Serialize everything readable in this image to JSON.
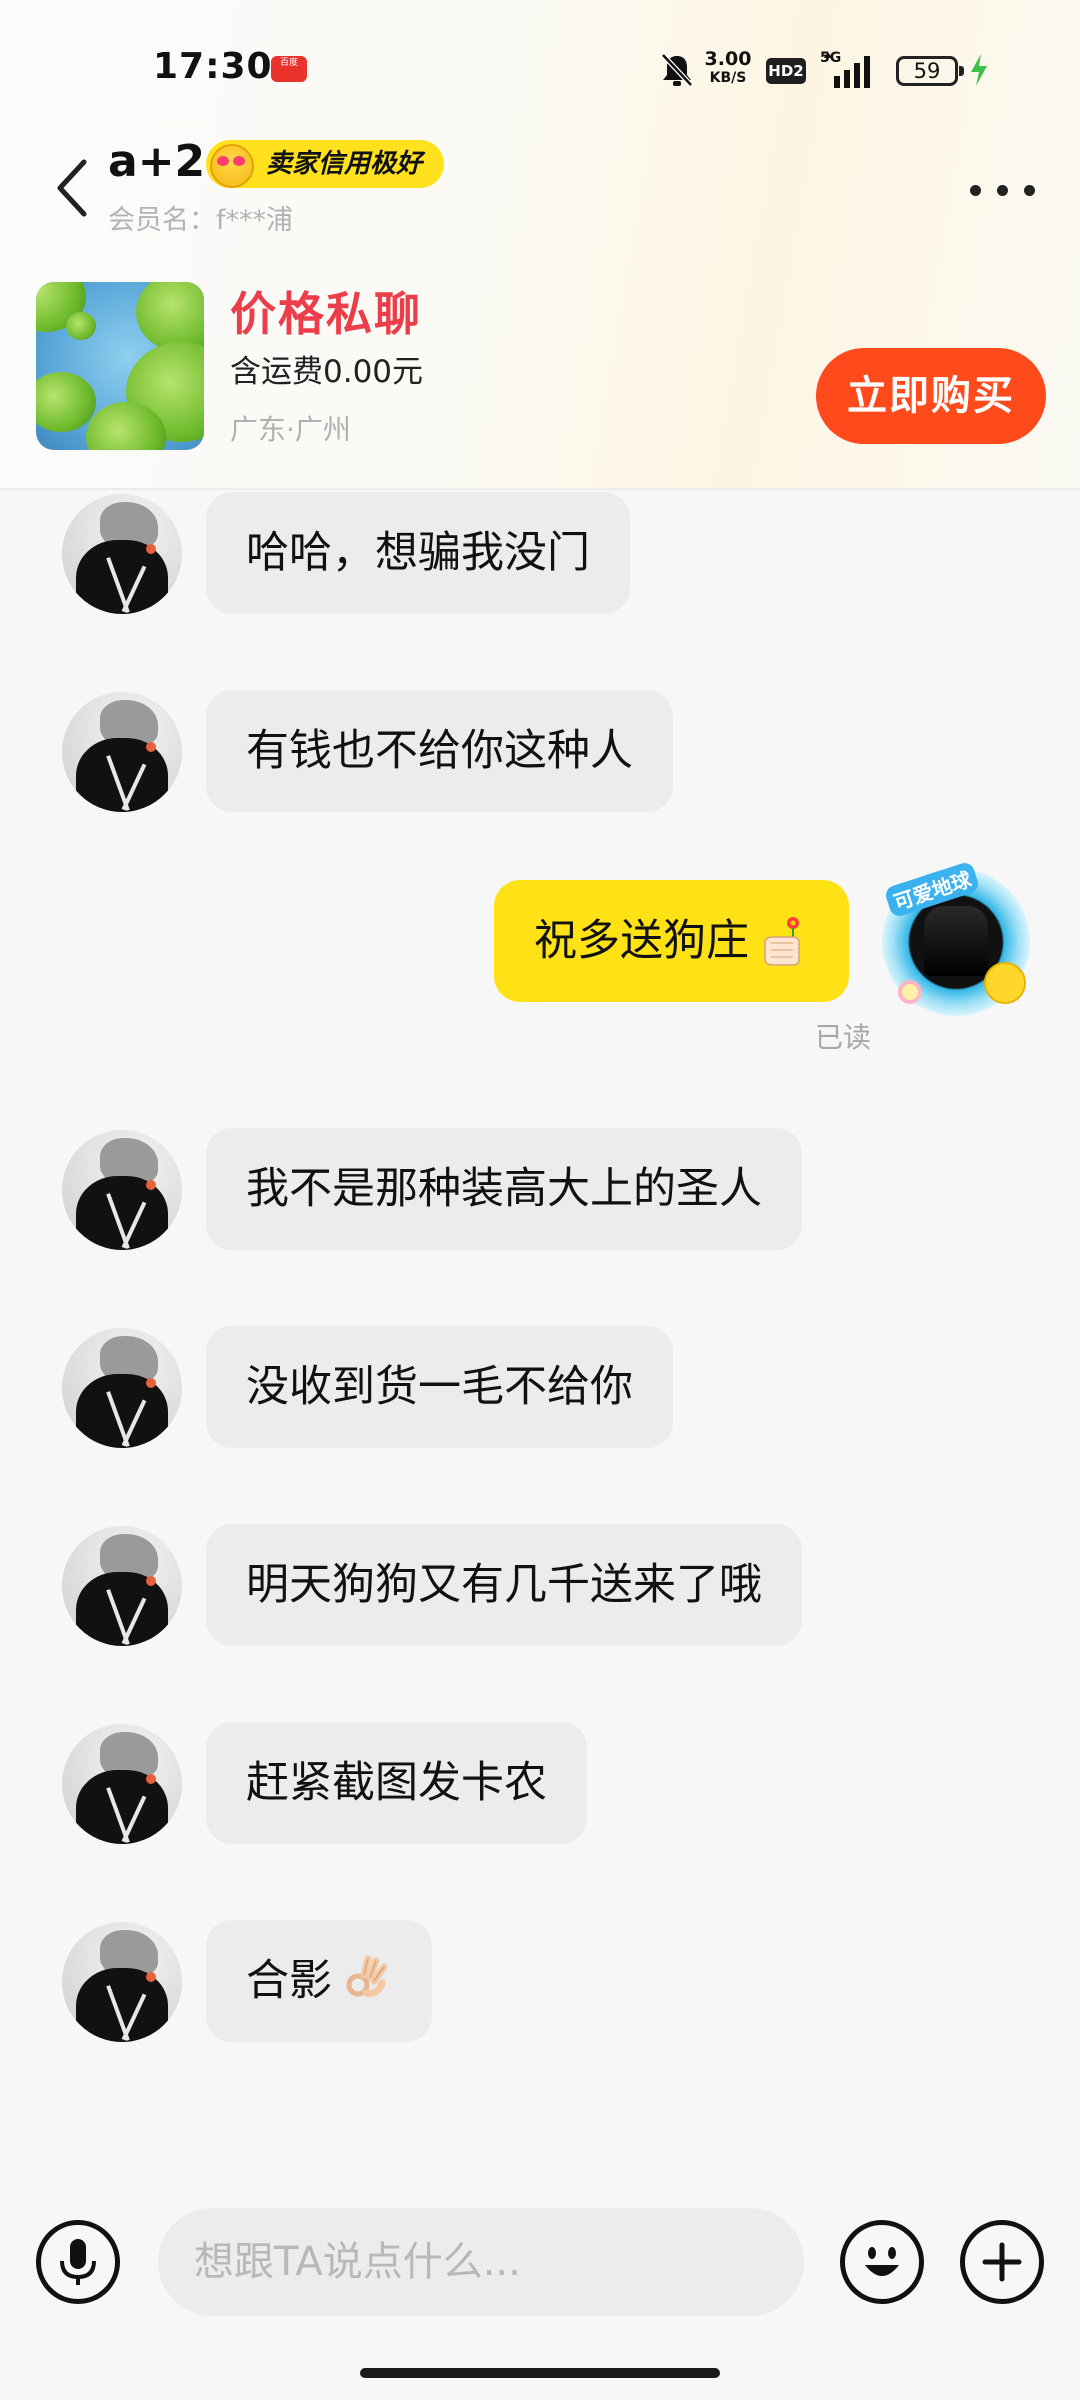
{
  "status_bar": {
    "time": "17:30",
    "app_badge_text": "百度",
    "net_speed_value": "3.00",
    "net_speed_unit": "KB/S",
    "hd_label": "HD2",
    "network_label": "5G",
    "battery_level": "59"
  },
  "header": {
    "seller_name": "a+2",
    "credit_badge": "卖家信用极好",
    "member_label": "会员名：f***浦"
  },
  "product": {
    "price_label": "价格私聊",
    "shipping": "含运费0.00元",
    "location": "广东·广州",
    "buy_label": "立即购买"
  },
  "messages": [
    {
      "side": "in",
      "text": "哈哈，想骗我没门"
    },
    {
      "side": "in",
      "text": "有钱也不给你这种人"
    },
    {
      "side": "out",
      "text": "祝多送狗庄",
      "emoji": "thumbs-up-flower",
      "read_status": "已读",
      "avatar_text": "可爱地球"
    },
    {
      "side": "in",
      "text": "我不是那种装高大上的圣人"
    },
    {
      "side": "in",
      "text": "没收到货一毛不给你"
    },
    {
      "side": "in",
      "text": "明天狗狗又有几千送来了哦"
    },
    {
      "side": "in",
      "text": "赶紧截图发卡农"
    },
    {
      "side": "in",
      "text": "合影",
      "emoji": "ok-hand"
    }
  ],
  "input_bar": {
    "placeholder": "想跟TA说点什么..."
  },
  "colors": {
    "accent_yellow": "#ffe215",
    "buy_orange": "#ff4a1c",
    "price_red": "#ec3d4b",
    "bubble_gray": "#ececec"
  },
  "icons": [
    "back-icon",
    "more-icon",
    "voice-icon",
    "emoji-icon",
    "plus-icon",
    "bell-off-icon",
    "signal-icon",
    "battery-icon",
    "charging-icon"
  ]
}
